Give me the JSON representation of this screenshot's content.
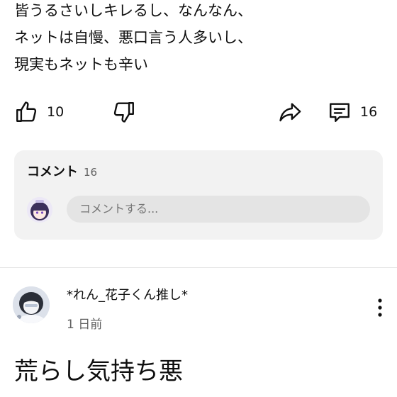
{
  "post": {
    "lines": [
      "皆うるさいしキレるし、なんなん、",
      "ネットは自慢、悪口言う人多いし、",
      "現実もネットも辛い"
    ]
  },
  "actions": {
    "like_icon": "thumbs-up-icon",
    "like_count": "10",
    "dislike_icon": "thumbs-down-icon",
    "share_icon": "share-icon",
    "comment_icon": "comment-icon",
    "comment_count": "16"
  },
  "comments_section": {
    "title": "コメント",
    "count": "16",
    "input_placeholder": "コメントする..."
  },
  "reply": {
    "username": "*れん_花子くん推し*",
    "timestamp": "1 日前",
    "text": "荒らし気持ち悪",
    "menu_icon": "more-vertical-icon"
  },
  "colors": {
    "text_primary": "#0f0f0f",
    "text_secondary": "#606060",
    "card_bg": "#f2f2f2",
    "input_bg": "#e4e4e4"
  }
}
